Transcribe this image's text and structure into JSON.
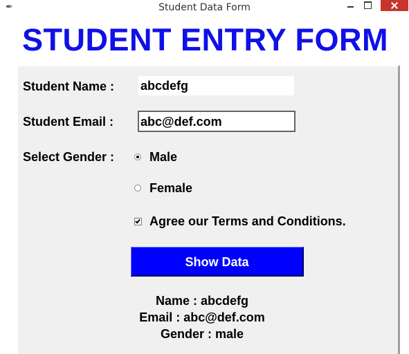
{
  "window": {
    "title": "Student Data Form",
    "icon": "feather-icon"
  },
  "form": {
    "banner": "STUDENT ENTRY FORM",
    "name_label": "Student Name :",
    "name_value": "abcdefg",
    "email_label": "Student Email :",
    "email_value": "abc@def.com",
    "gender_label": "Select Gender :",
    "gender_options": [
      {
        "label": "Male",
        "selected": true
      },
      {
        "label": "Female",
        "selected": false
      }
    ],
    "terms_label": "Agree our Terms and Conditions.",
    "terms_checked": true,
    "show_button_label": "Show Data"
  },
  "output": {
    "name_line": "Name : abcdefg",
    "email_line": "Email : abc@def.com",
    "gender_line": "Gender : male"
  },
  "colors": {
    "banner_text": "#1010e8",
    "button_bg": "#0000ff",
    "button_text": "#ffffff",
    "panel_bg": "#f0f0f0",
    "close_button": "#c7352b"
  }
}
